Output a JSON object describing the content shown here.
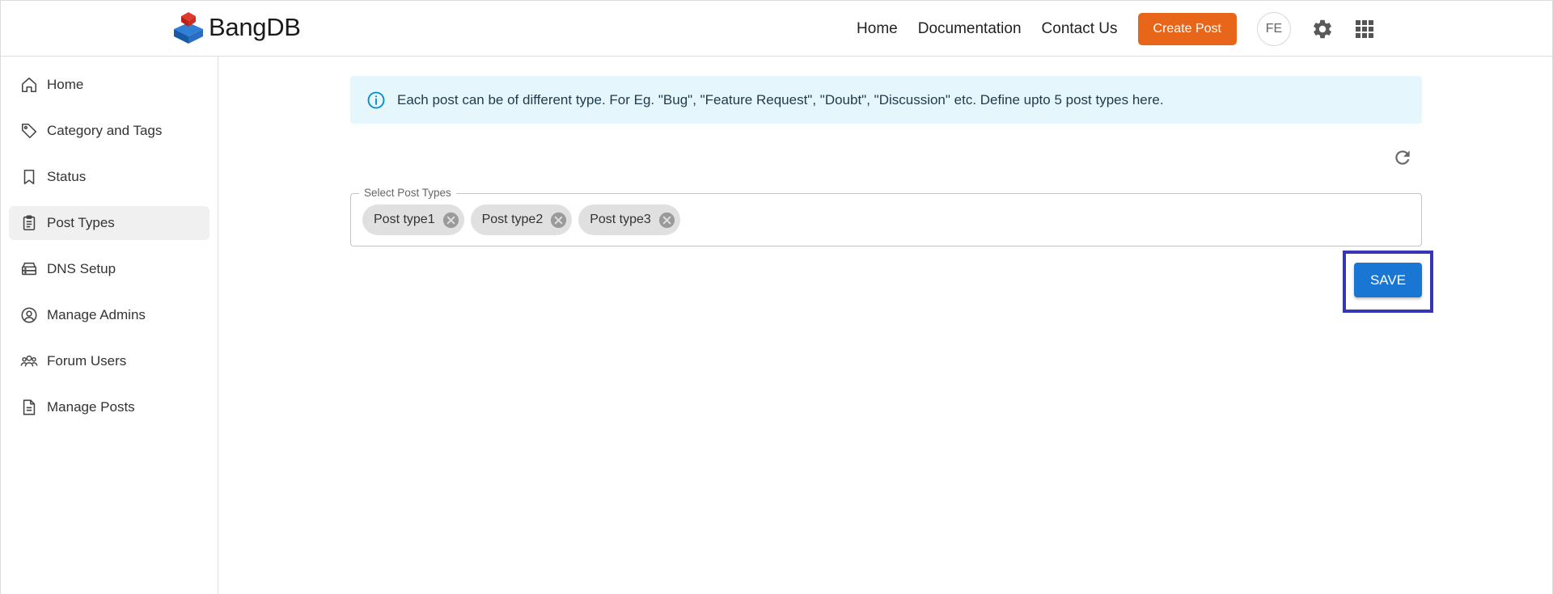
{
  "header": {
    "brand": "BangDB",
    "nav": [
      "Home",
      "Documentation",
      "Contact Us"
    ],
    "create_post_label": "Create Post",
    "avatar_initials": "FE",
    "accent_color": "#e8661a"
  },
  "sidebar": {
    "items": [
      {
        "label": "Home",
        "icon": "home-icon",
        "active": false
      },
      {
        "label": "Category and Tags",
        "icon": "tag-icon",
        "active": false
      },
      {
        "label": "Status",
        "icon": "bookmark-icon",
        "active": false
      },
      {
        "label": "Post Types",
        "icon": "clipboard-icon",
        "active": true
      },
      {
        "label": "DNS Setup",
        "icon": "server-icon",
        "active": false
      },
      {
        "label": "Manage Admins",
        "icon": "user-circle-icon",
        "active": false
      },
      {
        "label": "Forum Users",
        "icon": "users-icon",
        "active": false
      },
      {
        "label": "Manage Posts",
        "icon": "document-icon",
        "active": false
      }
    ]
  },
  "main": {
    "info_text": "Each post can be of different type. For Eg. \"Bug\", \"Feature Request\", \"Doubt\", \"Discussion\" etc. Define upto 5 post types here.",
    "select_label": "Select Post Types",
    "chips": [
      "Post type1",
      "Post type2",
      "Post type3"
    ],
    "save_label": "SAVE",
    "save_color": "#1976d2",
    "highlight_color": "#3535b5",
    "info_bg": "#e5f6fd"
  }
}
